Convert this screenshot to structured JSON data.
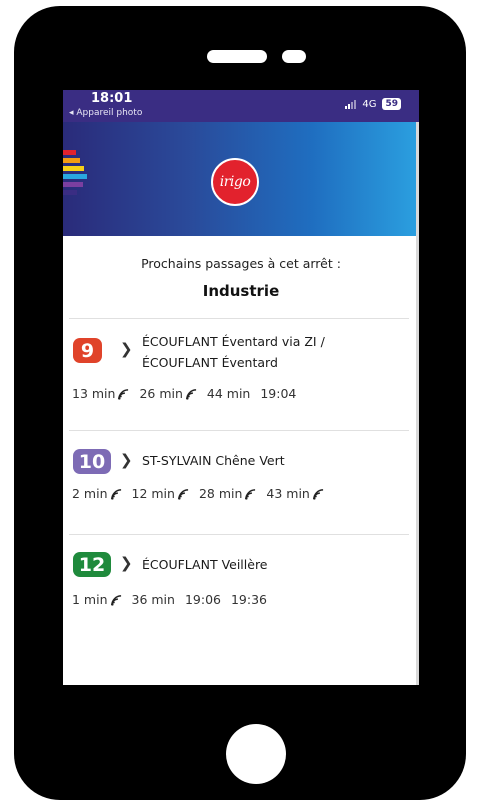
{
  "status_bar": {
    "time": "18:01",
    "back_label": "◂ Appareil photo",
    "network": "4G",
    "battery": "59"
  },
  "header": {
    "logo_text": "irigo",
    "stripe_colors": [
      "#e2222d",
      "#f39c12",
      "#f7d117",
      "#29a8e0",
      "#7b3fa0",
      "#3a2d83"
    ]
  },
  "page": {
    "subtitle": "Prochains passages à cet arrêt :",
    "stop_name": "Industrie"
  },
  "lines": [
    {
      "number": "9",
      "color": "#e0432a",
      "destination_lines": [
        "ÉCOUFLANT Éventard via ZI /",
        "ÉCOUFLANT Éventard"
      ],
      "times": [
        {
          "label": "13 min",
          "realtime": true
        },
        {
          "label": "26 min",
          "realtime": true
        },
        {
          "label": "44 min",
          "realtime": false
        },
        {
          "label": "19:04",
          "realtime": false
        }
      ]
    },
    {
      "number": "10",
      "color": "#7d6bb5",
      "destination_lines": [
        "ST-SYLVAIN Chêne Vert"
      ],
      "times": [
        {
          "label": "2 min",
          "realtime": true
        },
        {
          "label": "12 min",
          "realtime": true
        },
        {
          "label": "28 min",
          "realtime": true
        },
        {
          "label": "43 min",
          "realtime": true
        }
      ]
    },
    {
      "number": "12",
      "color": "#1f8a3c",
      "destination_lines": [
        "ÉCOUFLANT Veillère"
      ],
      "times": [
        {
          "label": "1 min",
          "realtime": true
        },
        {
          "label": "36 min",
          "realtime": false
        },
        {
          "label": "19:06",
          "realtime": false
        },
        {
          "label": "19:36",
          "realtime": false
        }
      ]
    }
  ],
  "icons": {
    "realtime": "realtime-signal-icon",
    "chevron": "chevron-right-icon",
    "signal": "cellular-signal-icon",
    "battery": "battery-icon"
  }
}
